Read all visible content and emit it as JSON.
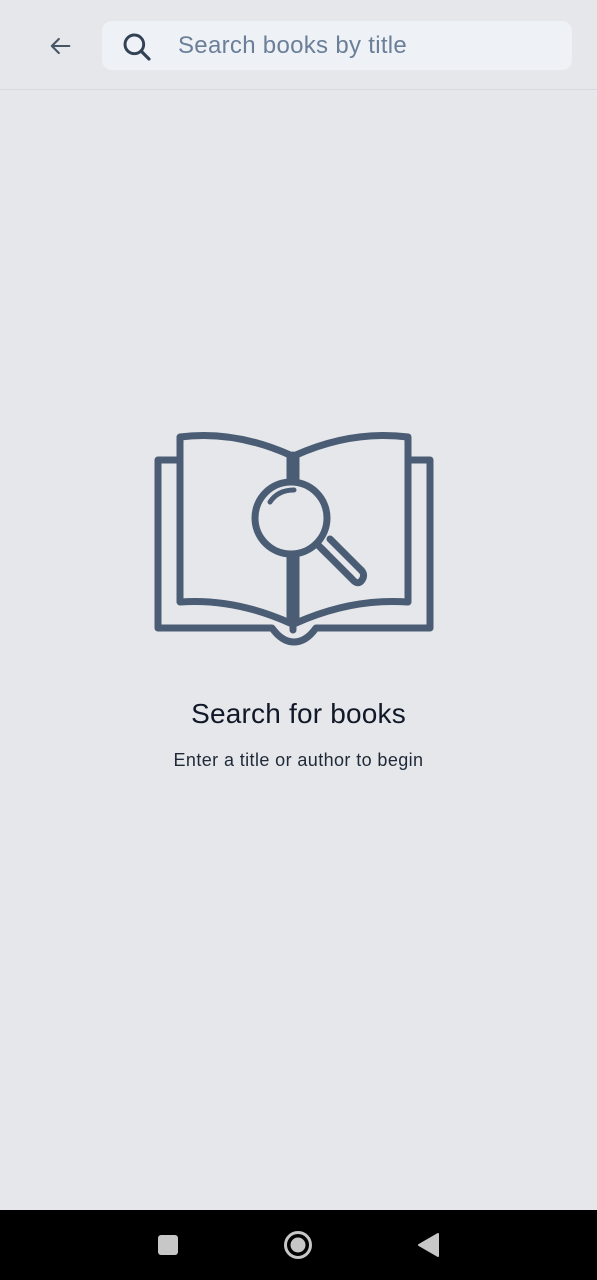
{
  "header": {
    "back_icon": "arrow-left-icon",
    "search": {
      "icon": "search-icon",
      "placeholder": "Search books by title",
      "value": ""
    }
  },
  "empty_state": {
    "illustration": "open-book-magnifier-icon",
    "title": "Search for books",
    "subtitle": "Enter a title or author to begin"
  },
  "system_nav": {
    "recents_icon": "square-recents-icon",
    "home_icon": "circle-home-icon",
    "back_icon": "triangle-back-icon"
  },
  "colors": {
    "background": "#e5e7eb",
    "search_field": "#eef1f6",
    "icon": "#475569",
    "illustration": "#4a5d74",
    "title_text": "#111827",
    "nav_bar": "#000000"
  }
}
